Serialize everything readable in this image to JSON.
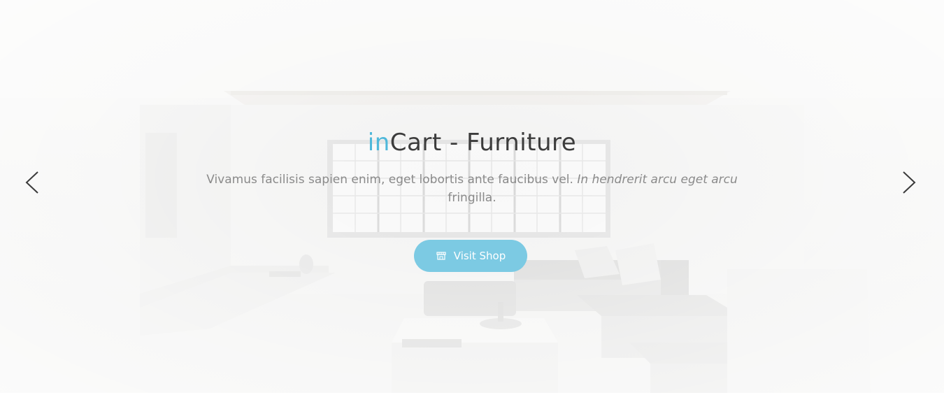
{
  "slider": {
    "title_accent": "in",
    "title_rest": "Cart - Furniture",
    "subtitle_regular": "Vivamus facilisis sapien enim, eget lobortis ante faucibus vel.",
    "subtitle_italic": "In hendrerit arcu eget arcu",
    "subtitle_tail": "fringilla.",
    "button_label": "Visit Shop",
    "button_icon": "shop-icon",
    "prev_icon": "chevron-left-icon",
    "next_icon": "chevron-right-icon"
  },
  "colors": {
    "accent": "#4fb8da",
    "button": "#7ccae3",
    "title": "#3c3c3c",
    "subtitle": "#8a8a8a"
  }
}
